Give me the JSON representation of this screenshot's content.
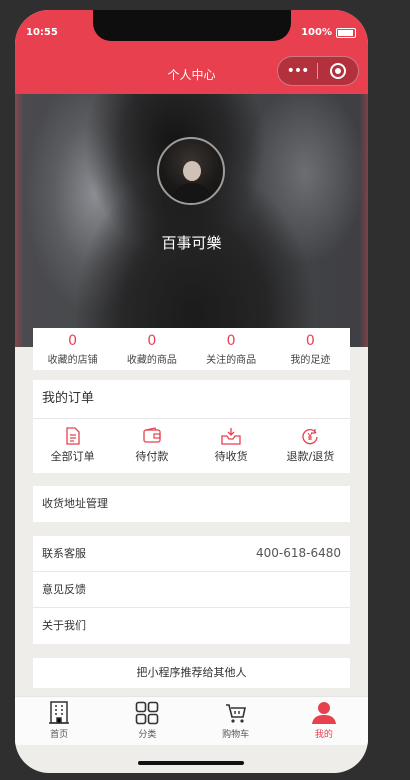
{
  "status": {
    "time": "10:55",
    "battery": "100%"
  },
  "nav": {
    "title": "个人中心",
    "more_icon": "•••",
    "close_icon": "target-icon"
  },
  "profile": {
    "username": "百事可樂"
  },
  "stats": [
    {
      "value": "0",
      "label": "收藏的店铺"
    },
    {
      "value": "0",
      "label": "收藏的商品"
    },
    {
      "value": "0",
      "label": "关注的商品"
    },
    {
      "value": "0",
      "label": "我的足迹"
    }
  ],
  "orders": {
    "title": "我的订单",
    "items": [
      {
        "label": "全部订单",
        "icon": "document-icon"
      },
      {
        "label": "待付款",
        "icon": "wallet-icon"
      },
      {
        "label": "待收货",
        "icon": "inbox-icon"
      },
      {
        "label": "退款/退货",
        "icon": "refund-icon"
      }
    ]
  },
  "address": {
    "label": "收货地址管理"
  },
  "service": {
    "contact_label": "联系客服",
    "contact_phone": "400-618-6480",
    "feedback_label": "意见反馈",
    "about_label": "关于我们"
  },
  "share": {
    "label": "把小程序推荐给其他人"
  },
  "tabbar": [
    {
      "label": "首页",
      "icon": "building-icon"
    },
    {
      "label": "分类",
      "icon": "grid-icon"
    },
    {
      "label": "购物车",
      "icon": "cart-icon"
    },
    {
      "label": "我的",
      "icon": "user-icon",
      "active": true
    }
  ],
  "colors": {
    "accent": "#e8404f",
    "background": "#efedea"
  }
}
